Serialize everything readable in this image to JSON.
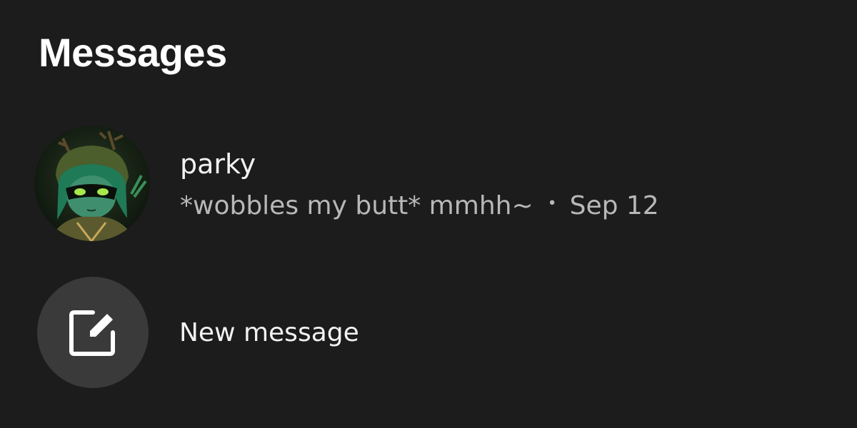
{
  "header": {
    "title": "Messages"
  },
  "conversations": [
    {
      "name": "parky",
      "preview": "*wobbles my butt* mmhh~",
      "separator": "•",
      "date": "Sep 12",
      "avatar_icon": "character-avatar"
    }
  ],
  "new_message": {
    "label": "New message",
    "icon": "compose-icon"
  },
  "colors": {
    "background": "#1c1c1c",
    "primary_text": "#f2f2f2",
    "secondary_text": "#b8b8b8",
    "compose_circle": "#3a3a3a"
  }
}
